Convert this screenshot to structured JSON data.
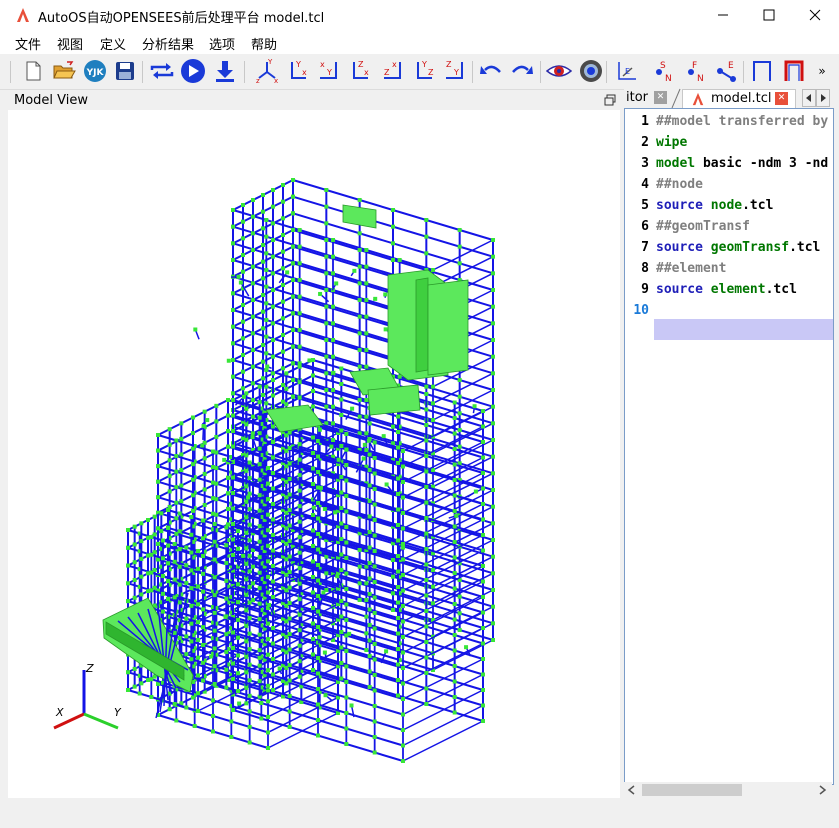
{
  "window": {
    "title": "AutoOS自动OPENSEES前后处理平台 model.tcl",
    "minimize": "—",
    "maximize": "☐",
    "close": "✕",
    "accent": "#e8503a"
  },
  "menu": [
    "文件",
    "视图",
    "定义",
    "分析结果",
    "选项",
    "帮助"
  ],
  "toolbar": {
    "icons": [
      "new-file-icon",
      "open-folder-icon",
      "yjk-icon",
      "save-icon",
      "refresh-icon",
      "play-icon",
      "download-icon",
      "axis-xyz-icon",
      "axis-yx-icon",
      "axis-xy-icon",
      "axis-zx-icon",
      "axis-zx2-icon",
      "axis-yz-icon",
      "axis-zy-icon",
      "undo-icon",
      "redo-icon",
      "eye-icon",
      "camera-icon",
      "element-axis-icon",
      "node-s-icon",
      "node-f-icon",
      "node-e-icon",
      "frame-icon",
      "frame-red-icon",
      "overflow-icon"
    ],
    "yjk_label": "YJK",
    "overflow": "»"
  },
  "model_view": {
    "label": "Model View",
    "triad": {
      "z": "Z",
      "x": "X",
      "y": "Y"
    },
    "colors": {
      "members": "#1414e6",
      "nodes": "#38e638",
      "walls": "#5ce85c"
    }
  },
  "editor": {
    "tabs": [
      {
        "label": "itor",
        "close": "✕"
      },
      {
        "label": "model.tcl",
        "close": "✕"
      }
    ],
    "lines": [
      {
        "num": "1",
        "parts": [
          {
            "t": "##model transferred by",
            "c": "comment"
          }
        ]
      },
      {
        "num": "2",
        "parts": [
          {
            "t": "wipe",
            "c": "green"
          }
        ]
      },
      {
        "num": "3",
        "parts": [
          {
            "t": "model",
            "c": "green"
          },
          {
            "t": " basic -ndm 3 -nd",
            "c": "plain"
          }
        ]
      },
      {
        "num": "4",
        "parts": [
          {
            "t": "##node",
            "c": "comment"
          }
        ]
      },
      {
        "num": "5",
        "parts": [
          {
            "t": "source",
            "c": "kw"
          },
          {
            "t": " ",
            "c": "plain"
          },
          {
            "t": "node",
            "c": "green"
          },
          {
            "t": ".tcl",
            "c": "plain"
          }
        ]
      },
      {
        "num": "6",
        "parts": [
          {
            "t": "##geomTransf",
            "c": "comment"
          }
        ]
      },
      {
        "num": "7",
        "parts": [
          {
            "t": "source",
            "c": "kw"
          },
          {
            "t": " ",
            "c": "plain"
          },
          {
            "t": "geomTransf",
            "c": "green"
          },
          {
            "t": ".tcl",
            "c": "plain"
          }
        ]
      },
      {
        "num": "8",
        "parts": [
          {
            "t": "##element",
            "c": "comment"
          }
        ]
      },
      {
        "num": "9",
        "parts": [
          {
            "t": "source",
            "c": "kw"
          },
          {
            "t": " ",
            "c": "plain"
          },
          {
            "t": "element",
            "c": "green"
          },
          {
            "t": ".tcl",
            "c": "plain"
          }
        ]
      },
      {
        "num": "10",
        "parts": []
      }
    ]
  }
}
